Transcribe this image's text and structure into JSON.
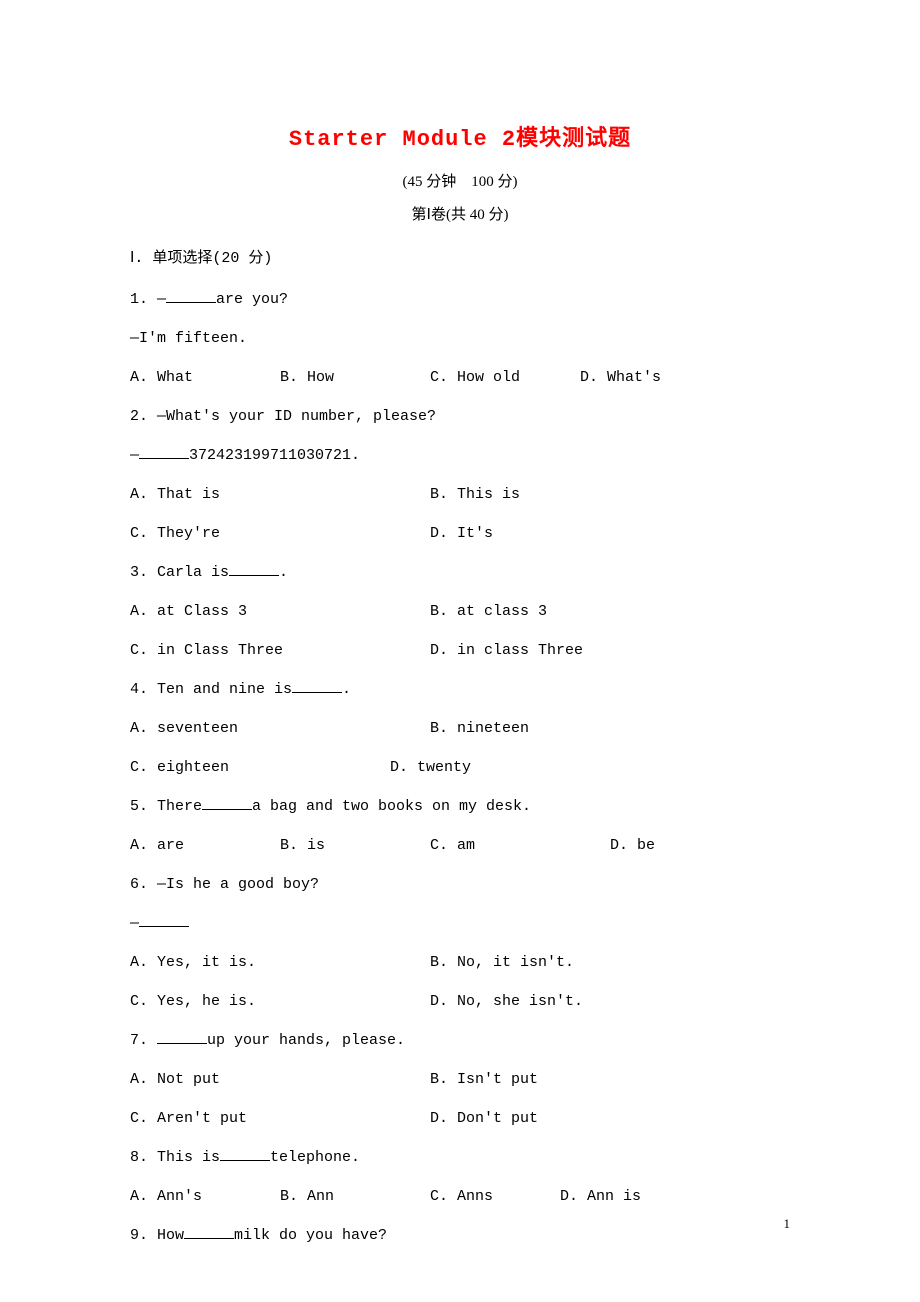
{
  "title_en": "Starter Module 2",
  "title_cn": "模块测试题",
  "subtitle": "(45 分钟　100 分)",
  "section_label": "第Ⅰ卷(共 40 分)",
  "section_heading": "Ⅰ. 单项选择(20 分)",
  "q1_line1_pre": "1. —",
  "q1_line1_post": "are you?",
  "q1_line2": "—I'm fifteen.",
  "q1_a": "A. What",
  "q1_b": "B. How",
  "q1_c": "C. How old",
  "q1_d": "D. What's",
  "q2_line1": "2. —What's your ID number, please?",
  "q2_line2_pre": "—",
  "q2_line2_post": "372423199711030721.",
  "q2_a": "A. That is",
  "q2_b": "B. This is",
  "q2_c": "C. They're",
  "q2_d": "D. It's",
  "q3_pre": "3. Carla is",
  "q3_post": ".",
  "q3_a": "A. at Class 3",
  "q3_b": "B. at class 3",
  "q3_c": "C. in Class Three",
  "q3_d": "D. in class Three",
  "q4_pre": "4. Ten and nine is",
  "q4_post": ".",
  "q4_a": "A. seventeen",
  "q4_b": "B. nineteen",
  "q4_c": "C. eighteen",
  "q4_d": "D. twenty",
  "q5_pre": "5. There",
  "q5_post": "a bag and two books on my desk.",
  "q5_a": "A. are",
  "q5_b": "B. is",
  "q5_c": "C. am",
  "q5_d": "D. be",
  "q6_line1": "6. —Is he a good boy?",
  "q6_line2": "—",
  "q6_a": "A. Yes, it is.",
  "q6_b": "B. No, it isn't.",
  "q6_c": "C. Yes, he is.",
  "q6_d": "D. No, she isn't.",
  "q7_pre": "7. ",
  "q7_post": "up your hands, please.",
  "q7_a": "A. Not put",
  "q7_b": "B. Isn't put",
  "q7_c": "C. Aren't put",
  "q7_d": "D. Don't put",
  "q8_pre": "8. This is",
  "q8_post": "telephone.",
  "q8_a": "A. Ann's",
  "q8_b": "B. Ann",
  "q8_c": "C. Anns",
  "q8_d": "D. Ann is",
  "q9_pre": "9. How",
  "q9_post": "milk do you have?",
  "page_number": "1"
}
